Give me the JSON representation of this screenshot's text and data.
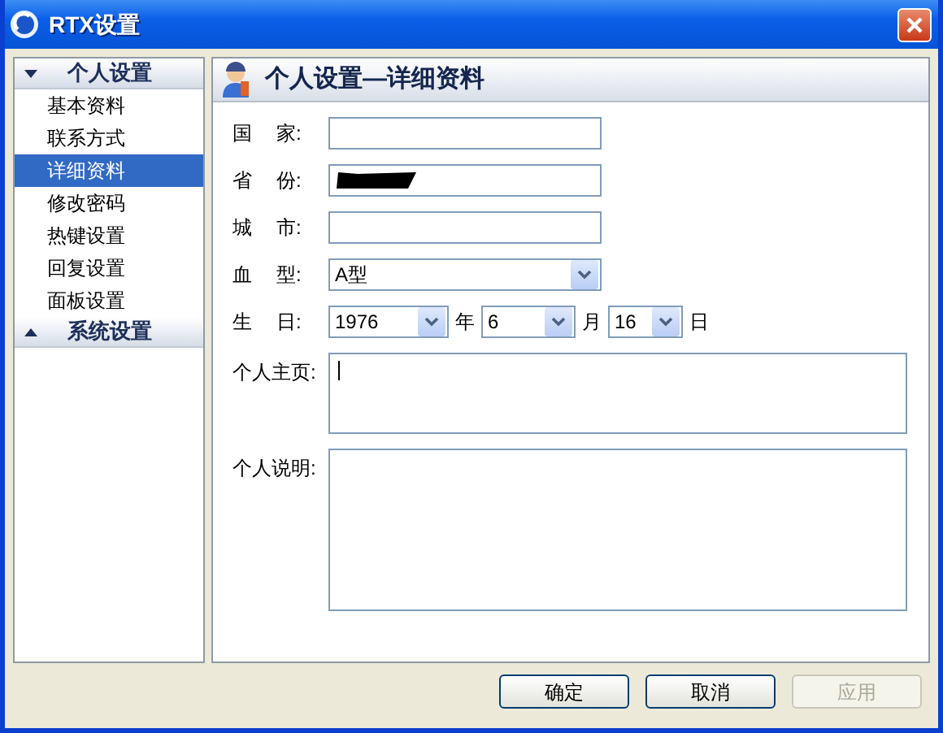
{
  "window": {
    "title": "RTX设置"
  },
  "sidebar": {
    "groups": [
      {
        "label": "个人设置",
        "expanded": true,
        "items": [
          {
            "label": "基本资料",
            "selected": false
          },
          {
            "label": "联系方式",
            "selected": false
          },
          {
            "label": "详细资料",
            "selected": true
          },
          {
            "label": "修改密码",
            "selected": false
          },
          {
            "label": "热键设置",
            "selected": false
          },
          {
            "label": "回复设置",
            "selected": false
          },
          {
            "label": "面板设置",
            "selected": false
          }
        ]
      },
      {
        "label": "系统设置",
        "expanded": false
      }
    ]
  },
  "panel": {
    "title": "个人设置—详细资料",
    "fields": [
      {
        "kind": "text",
        "label": [
          "国",
          "家:"
        ]
      },
      {
        "kind": "text",
        "label": [
          "省",
          "份:"
        ],
        "redacted": true
      },
      {
        "kind": "text",
        "label": [
          "城",
          "市:"
        ]
      },
      {
        "kind": "select",
        "label": [
          "血",
          "型:"
        ],
        "value": "A型"
      },
      {
        "kind": "date",
        "label": [
          "生",
          "日:"
        ],
        "parts": [
          {
            "value": "1976",
            "unit": "年"
          },
          {
            "value": "6",
            "unit": "月"
          },
          {
            "value": "16",
            "unit": "日"
          }
        ]
      },
      {
        "kind": "textarea",
        "label": "个人主页:",
        "focused": true
      },
      {
        "kind": "textarea",
        "label": "个人说明:"
      }
    ]
  },
  "buttons": [
    {
      "label": "确定",
      "disabled": false
    },
    {
      "label": "取消",
      "disabled": false
    },
    {
      "label": "应用",
      "disabled": true
    }
  ]
}
